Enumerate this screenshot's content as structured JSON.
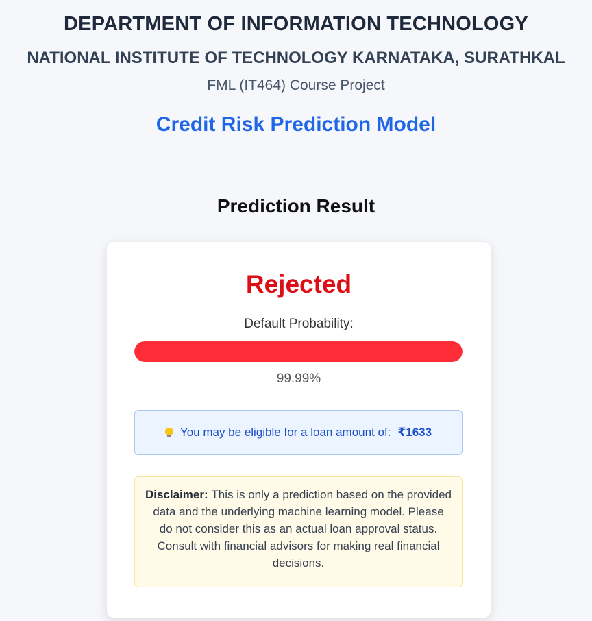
{
  "header": {
    "department": "DEPARTMENT OF INFORMATION TECHNOLOGY",
    "institute": "NATIONAL INSTITUTE OF TECHNOLOGY KARNATAKA, SURATHKAL",
    "course": "FML (IT464) Course Project",
    "model_title": "Credit Risk Prediction Model"
  },
  "result": {
    "heading": "Prediction Result",
    "status": "Rejected",
    "status_color": "#dc0f16",
    "probability_label": "Default Probability:",
    "probability_value": "99.99%",
    "probability_fraction": 0.9999,
    "bar_color": "#ff2d37",
    "loan_icon": "lightbulb-icon",
    "loan_text": "You may be eligible for a loan amount of:",
    "loan_amount": "₹1633",
    "disclaimer_label": "Disclaimer:",
    "disclaimer_text": "This is only a prediction based on the provided data and the underlying machine learning model. Please do not consider this as an actual loan approval status. Consult with financial advisors for making real financial decisions."
  },
  "colors": {
    "accent_blue": "#1f67e6",
    "loan_text_blue": "#1a4fc7"
  }
}
